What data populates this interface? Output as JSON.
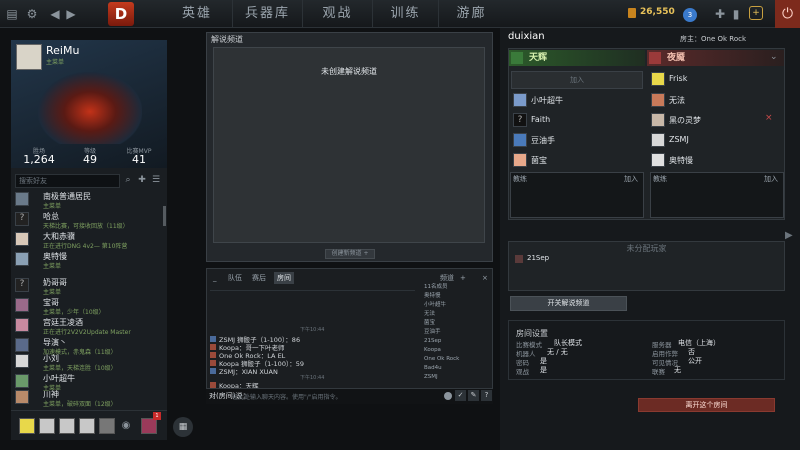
{
  "topbar": {
    "nav": [
      "英雄",
      "兵器库",
      "观战",
      "训练",
      "游廊"
    ],
    "gold": "26,550",
    "notification_count": "3"
  },
  "profile": {
    "username": "ReiMu",
    "role": "主菜单",
    "stats": [
      {
        "label": "胜场",
        "value": "1,264"
      },
      {
        "label": "等级",
        "value": "49"
      },
      {
        "label": "比赛MVP",
        "value": "41"
      }
    ]
  },
  "friends": {
    "search_placeholder": "搜索好友",
    "items": [
      {
        "name": "南极普通居民",
        "status": "主菜单"
      },
      {
        "name": "哈总",
        "status": "天梯比赛，可接收回放（11级）"
      },
      {
        "name": "大和赤骥",
        "status": "正在进行DNG 4v2— 第10阵营"
      },
      {
        "name": "奥特慢",
        "status": "主菜单"
      },
      {
        "name": "奶哥哥",
        "status": "主菜单"
      },
      {
        "name": "宝哥",
        "status": "主菜单，少年（10级）"
      },
      {
        "name": "宫廷王凌酒",
        "status": "正在进行2V2V2Update Master"
      },
      {
        "name": "导演丶",
        "status": "加速模式，赤鬼森（11级）"
      },
      {
        "name": "小刘",
        "status": "主菜单，天梯连胜（10级）"
      },
      {
        "name": "小叶超牛",
        "status": "主菜单"
      },
      {
        "name": "川神",
        "status": "主菜单，破碎双面（12级）"
      }
    ],
    "bottom_badge": "1"
  },
  "broadcast": {
    "title": "解说频道",
    "empty_text": "未创建解说频道",
    "create_label": "创建新频道"
  },
  "chat": {
    "tabs": [
      "队伍",
      "赛后",
      "房间"
    ],
    "channels_label": "频道",
    "messages": [
      {
        "text": "ZSMJ 狮骰子（1-100）：86",
        "time": "下午10:44"
      },
      {
        "text": "Koopa：哥一下叶老师"
      },
      {
        "text": "One Ok Rock：LA EL"
      },
      {
        "text": "Koopa 狮骰子（1-100）：59"
      },
      {
        "text": "ZSMJ：XIAN XUAN"
      },
      {
        "text": "Koopa：天辉",
        "time": "下午10:44"
      }
    ],
    "members": [
      "11名成员",
      "奥特慢",
      "小叶超牛",
      "无法",
      "菌宝",
      "豆油手",
      "21Sep",
      "Koopa",
      "One Ok Rock",
      "Bad4u",
      "ZSMJ"
    ],
    "input_label": "对(房间)说：",
    "input_placeholder": "在此处输入聊天内容。使用\"/\"启用指令。"
  },
  "lobby": {
    "name": "duixian",
    "host_label": "房主：One Ok Rock",
    "radiant": {
      "label": "天辉",
      "join": "加入",
      "players": [
        "小叶超牛",
        "Faith",
        "豆油手",
        "菌宝"
      ],
      "coach_label": "教练",
      "coach_join": "加入"
    },
    "dire": {
      "label": "夜魇",
      "players": [
        "Frisk",
        "无法",
        "黑の灵梦",
        "ZSMJ",
        "奥特慢"
      ],
      "coach_label": "教练",
      "coach_join": "加入"
    },
    "unassigned_label": "未分配玩家",
    "unassigned_player": "21Sep",
    "toggle_broadcast": "开关解说频道",
    "settings": {
      "title": "房间设置",
      "rows": [
        {
          "label": "比赛模式",
          "value": "队长模式"
        },
        {
          "label": "机器人",
          "value": "无 / 无"
        },
        {
          "label": "密码",
          "value": "是"
        },
        {
          "label": "观战",
          "value": "是"
        },
        {
          "label": "服务器",
          "value": "电信（上海）"
        },
        {
          "label": "启用作弊",
          "value": "否"
        },
        {
          "label": "可见情况",
          "value": "公开"
        },
        {
          "label": "联赛",
          "value": "无"
        }
      ]
    },
    "leave_label": "离开这个房间"
  },
  "colors": {
    "radiant": "#2c5a2a",
    "dire": "#5a2a2a",
    "leave": "#6c2b24",
    "gold": "#e8c25a"
  }
}
